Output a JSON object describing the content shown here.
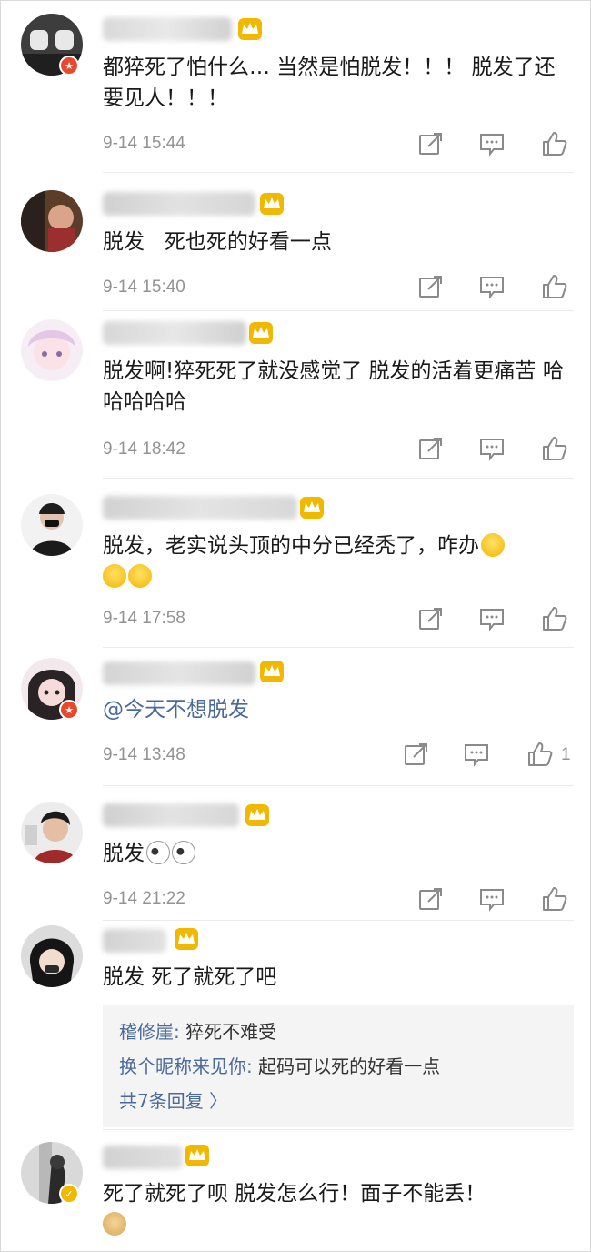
{
  "colors": {
    "meta": "#939393",
    "link": "#4a6a99",
    "crown": "#f1b800",
    "vip_badge": "#e8482d"
  },
  "comments": [
    {
      "text": "都猝死了怕什么… 当然是怕脱发！！！ 脱发了还要见人！！！",
      "time": "9-14 15:44",
      "badge": "red"
    },
    {
      "text": "脱发   死也死的好看一点",
      "time": "9-14 15:40"
    },
    {
      "text": "脱发啊!猝死死了就没感觉了 脱发的活着更痛苦 哈哈哈哈哈",
      "time": "9-14 18:42"
    },
    {
      "text": "脱发，老实说头顶的中分已经秃了，咋办",
      "time": "9-14 17:58",
      "emojis": [
        "crying-emoji",
        "crying-emoji",
        "crying-emoji"
      ]
    },
    {
      "text": "@今天不想脱发",
      "time": "9-14 13:48",
      "likes": "1",
      "badge": "red"
    },
    {
      "text": "脱发",
      "time": "9-14 21:22",
      "emojis": [
        "panda-emoji",
        "panda-emoji"
      ]
    },
    {
      "text": "脱发 死了就死了吧",
      "replies": [
        {
          "author": "稽修崖:",
          "text": " 猝死不难受"
        },
        {
          "author": "换个昵称来见你:",
          "text": " 起码可以死的好看一点"
        }
      ],
      "more_replies": "共7条回复 〉"
    },
    {
      "text": "死了就死了呗 脱发怎么行！面子不能丢！",
      "badge": "gold",
      "emojis": [
        "doge-emoji"
      ]
    }
  ],
  "icons": {
    "repost": "repost-icon",
    "comment": "comment-icon",
    "like": "like-icon",
    "crown": "crown-icon"
  }
}
